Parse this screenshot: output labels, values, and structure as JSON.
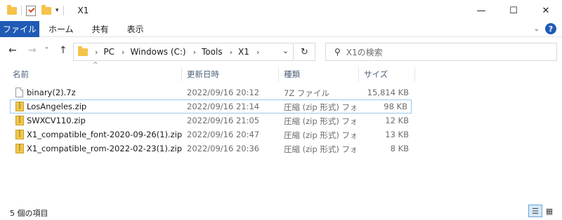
{
  "window": {
    "title": "X1",
    "minimize": "—",
    "maximize": "☐",
    "close": "✕"
  },
  "ribbon": {
    "file_tab": "ファイル",
    "tabs": [
      "ホーム",
      "共有",
      "表示"
    ],
    "help": "?"
  },
  "navigation": {
    "back": "←",
    "forward": "→",
    "recent": "˅",
    "up": "↑",
    "breadcrumb": [
      "PC",
      "Windows (C:)",
      "Tools",
      "X1"
    ],
    "refresh": "↻",
    "search_placeholder": "X1の検索"
  },
  "columns": {
    "name": "名前",
    "date": "更新日時",
    "type": "種類",
    "size": "サイズ"
  },
  "files": [
    {
      "name": "binary(2).7z",
      "date": "2022/09/16 20:12",
      "type": "7Z ファイル",
      "size": "15,814 KB",
      "icon": "document-icon"
    },
    {
      "name": "LosAngeles.zip",
      "date": "2022/09/16 21:14",
      "type": "圧縮 (zip 形式) フォ...",
      "size": "98 KB",
      "icon": "zip-folder-icon",
      "selected": true
    },
    {
      "name": "SWXCV110.zip",
      "date": "2022/09/16 21:05",
      "type": "圧縮 (zip 形式) フォ...",
      "size": "12 KB",
      "icon": "zip-folder-icon"
    },
    {
      "name": "X1_compatible_font-2020-09-26(1).zip",
      "date": "2022/09/16 20:47",
      "type": "圧縮 (zip 形式) フォ...",
      "size": "13 KB",
      "icon": "zip-folder-icon"
    },
    {
      "name": "X1_compatible_rom-2022-02-23(1).zip",
      "date": "2022/09/16 20:36",
      "type": "圧縮 (zip 形式) フォ...",
      "size": "8 KB",
      "icon": "zip-folder-icon"
    }
  ],
  "status": {
    "item_count": "5 個の項目"
  },
  "colors": {
    "accent": "#1f5bb5",
    "selection_border": "#99c9ef",
    "folder": "#f6c24a"
  }
}
